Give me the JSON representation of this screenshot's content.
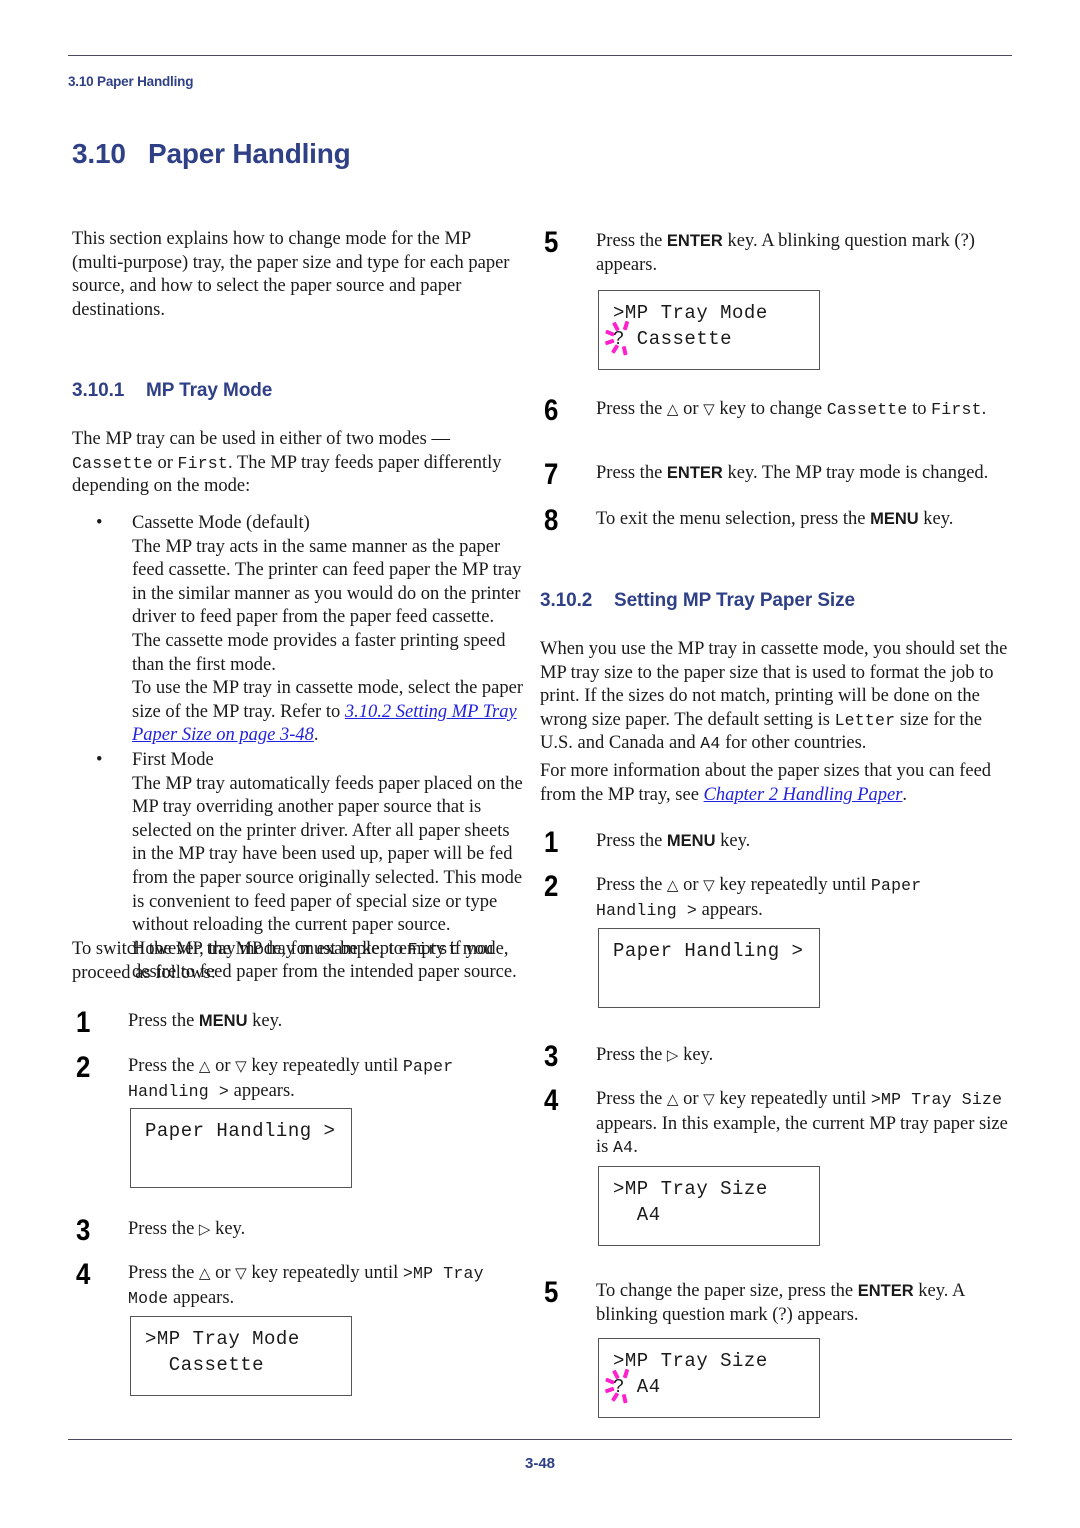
{
  "header": {
    "running_head": "3.10 Paper Handling"
  },
  "footer": {
    "page_number": "3-48"
  },
  "colors": {
    "heading_blue": "#2f4086",
    "link_blue": "#2222dd",
    "blink_magenta": "#ff22cc",
    "rule_gray": "#4a4a5e"
  },
  "section": {
    "number": "3.10",
    "title": "Paper Handling",
    "intro": "This section explains how to change mode for the MP (multi-purpose) tray, the paper size and type for each paper source, and how to select the paper source and paper destinations."
  },
  "subsection_1": {
    "number": "3.10.1",
    "title": "MP Tray Mode",
    "intro_a": "The MP tray can be used in either of two modes — ",
    "intro_mono_1": "Cassette",
    "intro_b": " or ",
    "intro_mono_2": "First",
    "intro_c": ". The MP tray feeds paper differently depending on the mode:",
    "bullets": [
      {
        "title": "Cassette Mode (default)",
        "paragraph_1": "The MP tray acts in the same manner as the paper feed cassette. The printer can feed paper the MP tray in the similar manner as you would do on the printer driver to feed paper from the paper feed cassette. The cassette mode provides a faster printing speed than the first mode.",
        "paragraph_2_a": "To use the MP tray in cassette mode, select the paper size of the MP tray. Refer to ",
        "paragraph_2_link": "3.10.2 Setting MP Tray Paper Size on page 3-48",
        "paragraph_2_b": "."
      },
      {
        "title": "First Mode",
        "paragraph_1": "The MP tray automatically feeds paper placed on the MP tray overriding another paper source that is selected on the printer driver. After all paper sheets in the MP tray have been used up, paper will be fed from the paper source originally selected. This mode is convenient to feed paper of special size or type without reloading the current paper source. However, the MP tray must be kept empty if you desire to feed paper from the intended paper source."
      }
    ],
    "switch_text_a": "To switch the MP tray mode, for example, to ",
    "switch_mono": "First",
    "switch_text_b": " mode, proceed as follows:",
    "steps": [
      {
        "number": "1",
        "text_a": "Press the ",
        "key": "MENU",
        "text_b": " key."
      },
      {
        "number": "2",
        "text_a": "Press the ",
        "text_mid": " or ",
        "text_b": " key repeatedly until ",
        "mono": "Paper Handling >",
        "text_c": " appears.",
        "panel": {
          "line1": "Paper Handling >",
          "line2": "",
          "blink": false
        }
      },
      {
        "number": "3",
        "text_a": "Press the ",
        "text_b": " key."
      },
      {
        "number": "4",
        "text_a": "Press the ",
        "text_mid": " or ",
        "text_b": " key repeatedly until ",
        "mono": ">MP Tray Mode",
        "text_c": " appears.",
        "panel": {
          "line1": ">MP Tray Mode",
          "line2": "  Cassette",
          "blink": false
        }
      },
      {
        "number": "5",
        "text_a": "Press the ",
        "key": "ENTER",
        "text_b": " key. A blinking question mark (?) appears.",
        "panel": {
          "line1": ">MP Tray Mode",
          "line2": "? Cassette",
          "blink": true
        }
      },
      {
        "number": "6",
        "text_a": "Press the ",
        "text_mid": " or ",
        "text_b": " key to change ",
        "mono": "Cassette",
        "text_c": " to ",
        "mono2": "First",
        "text_d": "."
      },
      {
        "number": "7",
        "text_a": "Press the ",
        "key": "ENTER",
        "text_b": " key. The MP tray mode is changed."
      },
      {
        "number": "8",
        "text_a": "To exit the menu selection, press the ",
        "key": "MENU",
        "text_b": " key."
      }
    ]
  },
  "subsection_2": {
    "number": "3.10.2",
    "title": "Setting MP Tray Paper Size",
    "paragraph_1_a": "When you use the MP tray in cassette mode, you should set the MP tray size to the paper size that is used to format the job to print. If the sizes do not match, printing will be done on the wrong size paper. The default setting is ",
    "paragraph_1_mono_1": "Letter",
    "paragraph_1_b": " size for the U.S. and Canada and ",
    "paragraph_1_mono_2": "A4",
    "paragraph_1_c": " for other countries.",
    "paragraph_2_a": "For more information about the paper sizes that you can feed from the MP tray, see ",
    "paragraph_2_link": "Chapter 2 Handling Paper",
    "paragraph_2_b": ".",
    "steps": [
      {
        "number": "1",
        "text_a": "Press the ",
        "key": "MENU",
        "text_b": " key."
      },
      {
        "number": "2",
        "text_a": "Press the ",
        "text_mid": " or ",
        "text_b": " key repeatedly until ",
        "mono": "Paper Handling >",
        "text_c": " appears.",
        "panel": {
          "line1": "Paper Handling >",
          "line2": "",
          "blink": false
        }
      },
      {
        "number": "3",
        "text_a": "Press the ",
        "text_b": " key."
      },
      {
        "number": "4",
        "text_a": "Press the ",
        "text_mid": " or ",
        "text_b": " key repeatedly until ",
        "mono": ">MP Tray Size",
        "text_c": " appears. In this example, the current MP tray paper size is ",
        "mono2": "A4",
        "text_d": ".",
        "panel": {
          "line1": ">MP Tray Size",
          "line2": "  A4",
          "blink": false
        }
      },
      {
        "number": "5",
        "text_a": "To change the paper size, press the ",
        "key": "ENTER",
        "text_b": " key. A blinking question mark (?) appears.",
        "panel": {
          "line1": ">MP Tray Size",
          "line2": "? A4",
          "blink": true
        }
      }
    ]
  }
}
